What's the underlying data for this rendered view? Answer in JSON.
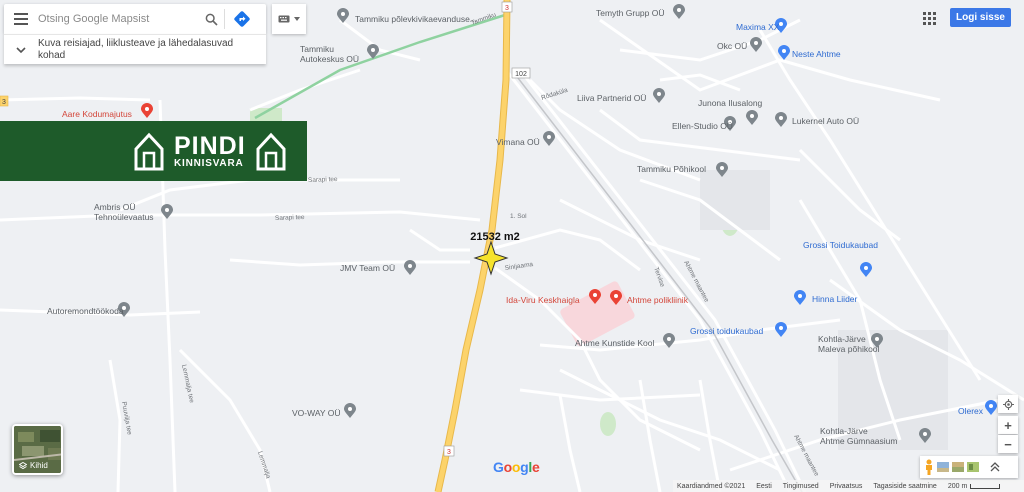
{
  "search": {
    "placeholder": "Otsing Google Mapsist"
  },
  "suggestion": {
    "text": "Kuva reisiajad, liiklusteave ja lähedalasuvad kohad"
  },
  "header": {
    "login_label": "Logi sisse"
  },
  "banner": {
    "brand_line1": "PINDI",
    "brand_line2": "KINNISVARA",
    "bg_color": "#1e5b2a"
  },
  "marker": {
    "label": "21532 m2",
    "color": "#f6e32c"
  },
  "layers": {
    "label": "Kihid"
  },
  "zoom": {
    "in": "+",
    "out": "−"
  },
  "google_logo": {
    "letters": [
      {
        "ch": "G",
        "color": "#4285f4"
      },
      {
        "ch": "o",
        "color": "#ea4335"
      },
      {
        "ch": "o",
        "color": "#fbbc05"
      },
      {
        "ch": "g",
        "color": "#4285f4"
      },
      {
        "ch": "l",
        "color": "#34a853"
      },
      {
        "ch": "e",
        "color": "#ea4335"
      }
    ]
  },
  "footer": {
    "map_data": "Kaardiandmed ©2021",
    "country": "Eesti",
    "terms": "Tingimused",
    "privacy": "Privaatsus",
    "feedback": "Tagasiside saatmine",
    "scale": "200 m"
  },
  "places": [
    {
      "name": "Temyth Grupp OÜ",
      "icon": "pin"
    },
    {
      "name": "Maxima XX",
      "icon": "shop",
      "color": "#4285f4"
    },
    {
      "name": "Okc OÜ",
      "icon": "pin"
    },
    {
      "name": "Neste Ahtme",
      "icon": "fuel",
      "color": "#4285f4"
    },
    {
      "name": "Tammiku põlevkivikaevanduse...",
      "icon": "pin"
    },
    {
      "name": "Tammiku Autokeskus OÜ",
      "icon": "pin"
    },
    {
      "name": "Aare Kodumajutus",
      "icon": "lodging",
      "color": "#ea4335"
    },
    {
      "name": "Liiva Partnerid OÜ",
      "icon": "pin"
    },
    {
      "name": "Junona Ilusalong",
      "icon": "pin"
    },
    {
      "name": "Ellen-Studio OÜ",
      "icon": "pin"
    },
    {
      "name": "Lukernel Auto OÜ",
      "icon": "pin"
    },
    {
      "name": "Vimana OÜ",
      "icon": "pin"
    },
    {
      "name": "Tammiku Põhikool",
      "icon": "pin"
    },
    {
      "name": "Ambris OÜ Tehnoülevaatus",
      "icon": "pin"
    },
    {
      "name": "JMV Team OÜ",
      "icon": "pin"
    },
    {
      "name": "Grossi Toidukaubad",
      "icon": "shop",
      "color": "#4285f4"
    },
    {
      "name": "Hinna Liider",
      "icon": "shop",
      "color": "#4285f4"
    },
    {
      "name": "Ida-Viru Keskhaigla",
      "icon": "hospital",
      "color": "#ea4335"
    },
    {
      "name": "Ahtme polikliinik",
      "icon": "hospital",
      "color": "#ea4335"
    },
    {
      "name": "Autoremondtöökoda",
      "icon": "pin"
    },
    {
      "name": "Grossi toidukaubad",
      "icon": "shop",
      "color": "#4285f4"
    },
    {
      "name": "Ahtme Kunstide Kool",
      "icon": "pin"
    },
    {
      "name": "Kohtla-Järve Maleva põhikool",
      "icon": "pin"
    },
    {
      "name": "VO-WAY OÜ",
      "icon": "pin"
    },
    {
      "name": "Olerex",
      "icon": "fuel",
      "color": "#4285f4"
    },
    {
      "name": "Kohtla-Järve Ahtme Gümnaasium",
      "icon": "pin"
    }
  ],
  "road_labels": [
    {
      "text": "Tammiku"
    },
    {
      "text": "Ahtme maantee"
    },
    {
      "text": "Ahtme maantee"
    },
    {
      "text": "Sarapi tee"
    },
    {
      "text": "Sarapi tee"
    },
    {
      "text": "Sinijaama"
    },
    {
      "text": "Lemmalja tee"
    },
    {
      "text": "Tervise"
    },
    {
      "text": "Puuvilja tee"
    },
    {
      "text": "Lemmalja"
    },
    {
      "text": "Rõdaküla"
    },
    {
      "text": "1. Sol"
    }
  ],
  "road_badges": [
    {
      "text": "3"
    },
    {
      "text": "102"
    },
    {
      "text": "3"
    },
    {
      "text": "3"
    }
  ]
}
